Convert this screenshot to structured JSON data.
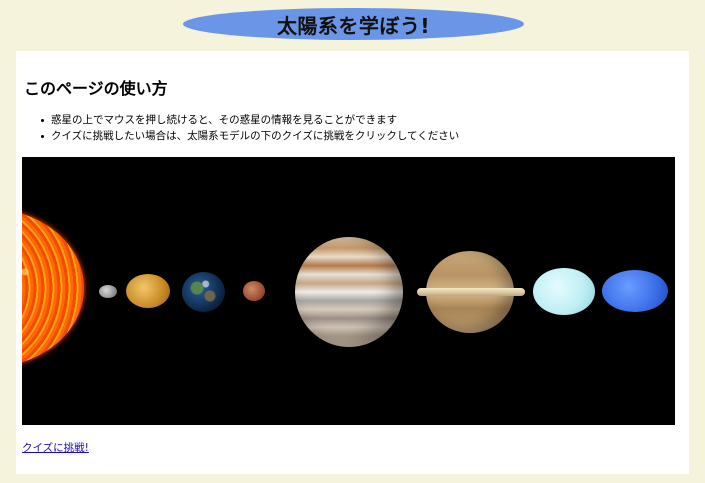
{
  "header": {
    "title": "太陽系を学ぼう!"
  },
  "main": {
    "section_title": "このページの使い方",
    "instructions": [
      "惑星の上でマウスを押し続けると、その惑星の情報を見ることができます",
      "クイズに挑戦したい場合は、太陽系モデルの下のクイズに挑戦をクリックしてください"
    ],
    "quiz_link": "クイズに挑戦!"
  },
  "solar_system": {
    "planets": [
      "sun",
      "mercury",
      "venus",
      "earth",
      "mars",
      "jupiter",
      "saturn",
      "uranus",
      "neptune"
    ]
  },
  "colors": {
    "page_background": "#f5f3dc",
    "title_oval": "#6b95e6",
    "content_background": "#ffffff",
    "space_background": "#000000",
    "link": "#1a0dab"
  }
}
